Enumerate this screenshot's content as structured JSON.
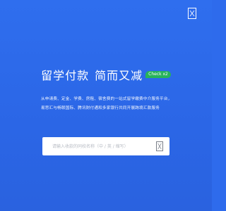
{
  "header": {
    "menu_icon": "menu-icon"
  },
  "hero": {
    "title_part1": "留学付款",
    "title_part2": "简而又减",
    "badge": "Check x2",
    "description": "从申请费、定金、学费、房租、宿舍费的一站式留学缴费中介服务平台，易思汇与畅联国际、腾讯财付通和多家银行共同开展跨境汇款服务"
  },
  "search": {
    "placeholder": "请输入收款的同校名称（中 / 英 / 缩写）",
    "icon": "search-icon"
  },
  "colors": {
    "background": "#2e6bec",
    "badge": "#27b35b",
    "text": "#ffffff"
  }
}
